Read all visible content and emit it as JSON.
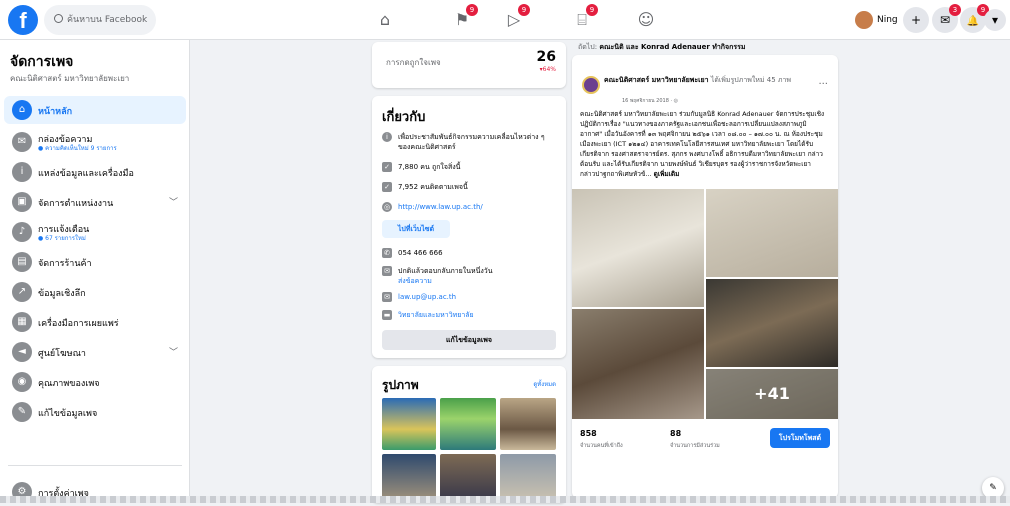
{
  "topbar": {
    "logo_glyph": "f",
    "search_placeholder": "ค้นหาบน Facebook",
    "nav": [
      {
        "name": "home-icon",
        "glyph": "⌂",
        "badge": ""
      },
      {
        "name": "flag-icon",
        "glyph": "⚑",
        "badge": "9"
      },
      {
        "name": "video-icon",
        "glyph": "▷",
        "badge": "9"
      },
      {
        "name": "marketplace-icon",
        "glyph": "⌸",
        "badge": "9"
      },
      {
        "name": "groups-icon",
        "glyph": "☺",
        "badge": ""
      }
    ],
    "user_name": "Ning",
    "right_buttons": [
      {
        "name": "create-icon",
        "glyph": "+",
        "badge": ""
      },
      {
        "name": "messenger-icon",
        "glyph": "✉",
        "badge": "3"
      },
      {
        "name": "notifications-icon",
        "glyph": "🔔",
        "badge": "9"
      },
      {
        "name": "account-menu-icon",
        "glyph": "▾",
        "badge": ""
      }
    ]
  },
  "sidebar": {
    "title": "จัดการเพจ",
    "subtitle": "คณะนิติศาสตร์ มหาวิทยาลัยพะเยา",
    "items": [
      {
        "label": "หน้าหลัก",
        "sub": "",
        "icon": "home-icon",
        "glyph": "⌂",
        "chevron": false,
        "active": true
      },
      {
        "label": "กล่องข้อความ",
        "sub": "● ความคิดเห็นใหม่ 9 รายการ",
        "icon": "inbox-icon",
        "glyph": "✉",
        "chevron": false,
        "active": false
      },
      {
        "label": "แหล่งข้อมูลและเครื่องมือ",
        "sub": "",
        "icon": "info-icon",
        "glyph": "i",
        "chevron": false,
        "active": false
      },
      {
        "label": "จัดการตำแหน่งงาน",
        "sub": "",
        "icon": "briefcase-icon",
        "glyph": "▣",
        "chevron": true,
        "active": false
      },
      {
        "label": "การแจ้งเตือน",
        "sub": "● 67 รายการใหม่",
        "icon": "bell-icon",
        "glyph": "♪",
        "chevron": false,
        "active": false
      },
      {
        "label": "จัดการร้านค้า",
        "sub": "",
        "icon": "shop-icon",
        "glyph": "▤",
        "chevron": false,
        "active": false
      },
      {
        "label": "ข้อมูลเชิงลึก",
        "sub": "",
        "icon": "insights-icon",
        "glyph": "↗",
        "chevron": false,
        "active": false
      },
      {
        "label": "เครื่องมือการเผยแพร่",
        "sub": "",
        "icon": "publishing-tools-icon",
        "glyph": "▦",
        "chevron": false,
        "active": false
      },
      {
        "label": "ศูนย์โฆษณา",
        "sub": "",
        "icon": "megaphone-icon",
        "glyph": "◄",
        "chevron": true,
        "active": false
      },
      {
        "label": "คุณภาพของเพจ",
        "sub": "",
        "icon": "quality-icon",
        "glyph": "◉",
        "chevron": false,
        "active": false
      },
      {
        "label": "แก้ไขข้อมูลเพจ",
        "sub": "",
        "icon": "pencil-icon",
        "glyph": "✎",
        "chevron": false,
        "active": false
      }
    ],
    "settings_label": "การตั้งค่าเพจ"
  },
  "likes_card": {
    "label": "การกดถูกใจเพจ",
    "value": "26",
    "change": "▾64%"
  },
  "about": {
    "title": "เกี่ยวกับ",
    "rows": [
      {
        "icon": "info-icon",
        "glyph": "i",
        "text": "เพื่อประชาสัมพันธ์กิจกรรมความเคลื่อนไหวต่าง ๆ ของคณะนิติศาสตร์",
        "link": false
      },
      {
        "icon": "like-icon",
        "glyph": "👍",
        "text": "7,880 คน ถูกใจสิ่งนี้",
        "link": false
      },
      {
        "icon": "check-icon",
        "glyph": "✓",
        "text": "7,952 คนติดตามเพจนี้",
        "link": false
      },
      {
        "icon": "globe-icon",
        "glyph": "◎",
        "text": "http://www.law.up.ac.th/",
        "link": true
      },
      {
        "icon": "phone-icon",
        "glyph": "✆",
        "text": "054 466 666",
        "link": false
      },
      {
        "icon": "chat-icon",
        "glyph": "✉",
        "text": "ปกติแล้วตอบกลับภายในหนึ่งวัน",
        "link": false
      },
      {
        "icon": "email-icon",
        "glyph": "✉",
        "text": "law.up@up.ac.th",
        "link": true
      },
      {
        "icon": "folder-icon",
        "glyph": "▬",
        "text": "วิทยาลัยและมหาวิทยาลัย",
        "link": true
      }
    ],
    "send_message": "ส่งข้อความ",
    "visit_site": "ไปที่เว็บไซต์",
    "edit_info": "แก้ไขข้อมูลเพจ"
  },
  "photos": {
    "title": "รูปภาพ",
    "see_all": "ดูทั้งหมด"
  },
  "post": {
    "tagline_prefix": "ถัดไป:",
    "tagline_names": "คณะนิติ และ Konrad Adenauer ทำกิจกรรม",
    "author": "คณะนิติศาสตร์ มหาวิทยาลัยพะเยา",
    "action": "ได้เพิ่มรูปภาพใหม่ 45 ภาพ",
    "date": "16 พฤศจิกายน 2018 · ◎",
    "more": "···",
    "body": "คณะนิติศาสตร์ มหาวิทยาลัยพะเยา ร่วมกับมูลนิธิ Konrad Adenauer จัดการประชุมเชิงปฏิบัติการเรื่อง \"แนวทางของภาครัฐและเอกชนเพื่อชะลอการเปลี่ยนแปลงสภาพภูมิอากาศ\" เมื่อวันอังคารที่ ๑๓ พฤศจิกายน ๒๕๖๑ เวลา ๐๘.๐๐ – ๑๗.๐๐ น. ณ ห้องประชุมเมืองพะเยา (ICT ๑๒๑๔) อาคารเทคโนโลยีสารสนเทศ มหาวิทยาลัยพะเยา โดยได้รับเกียรติจาก รองศาสตราจารย์ดร. สุภกร พงศบางโพธิ์ อธิการบดีมหาวิทยาลัยพะเยา กล่าวต้อนรับ และได้รับเกียรติจาก นายพงษ์พันธ์ วิเชียรบุตร รองผู้ว่าราชการจังหวัดพะเยา กล่าวปาฐกถาพิเศษหัวข้... ",
    "see_more": "ดูเพิ่มเติม",
    "extra_photos": "+41",
    "reach": "858",
    "reach_label": "จำนวนคนที่เข้าถึง",
    "engagement": "88",
    "engagement_label": "จำนวนการมีส่วนร่วม",
    "boost": "โปรโมทโพสต์"
  },
  "colors": {
    "brand": "#1877f2",
    "badge": "#e41e3f"
  }
}
